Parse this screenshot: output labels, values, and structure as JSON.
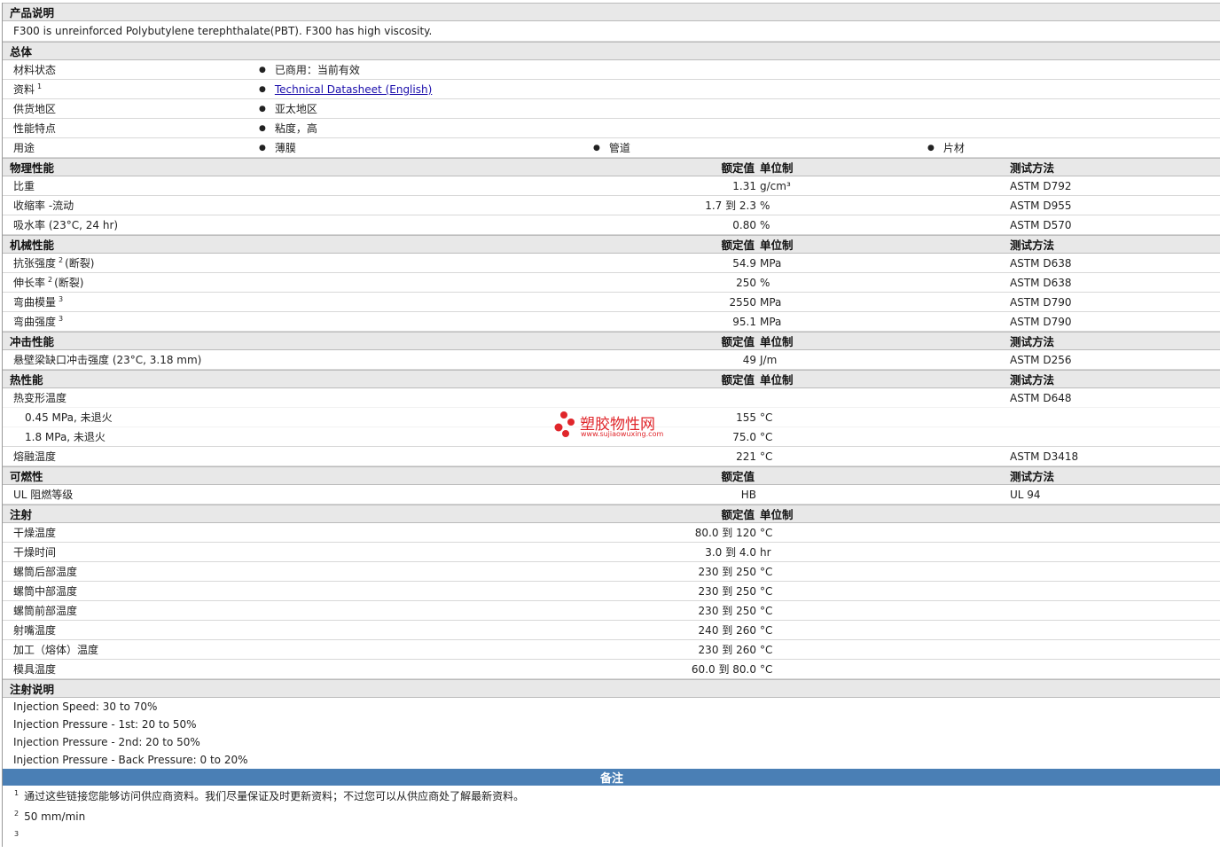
{
  "product_desc": {
    "header": "产品说明",
    "text": "F300 is unreinforced Polybutylene terephthalate(PBT). F300 has high viscosity."
  },
  "general": {
    "header": "总体",
    "status_label": "材料状态",
    "status_value": "已商用：当前有效",
    "resource_label": "资料",
    "resource_sup": "1",
    "resource_link": "Technical Datasheet (English)",
    "region_label": "供货地区",
    "region_value": "亚太地区",
    "features_label": "性能特点",
    "features_value": "粘度，高",
    "uses_label": "用途",
    "uses": [
      "薄膜",
      "管道",
      "片材"
    ]
  },
  "col_headers": {
    "value": "额定值",
    "unit": "单位制",
    "test": "测试方法"
  },
  "physical": {
    "header": "物理性能",
    "rows": [
      {
        "label": "比重",
        "value": "1.31",
        "unit": "g/cm³",
        "test": "ASTM D792"
      },
      {
        "label": "收缩率 -流动",
        "value": "1.7 到  2.3",
        "unit": "%",
        "test": "ASTM D955"
      },
      {
        "label": "吸水率  (23°C, 24 hr)",
        "value": "0.80",
        "unit": "%",
        "test": "ASTM D570"
      }
    ]
  },
  "mechanical": {
    "header": "机械性能",
    "rows": [
      {
        "label": "抗张强度",
        "sup": "2",
        "suffix": "(断裂)",
        "value": "54.9",
        "unit": "MPa",
        "test": "ASTM D638"
      },
      {
        "label": "伸长率",
        "sup": "2",
        "suffix": "(断裂)",
        "value": "250",
        "unit": "%",
        "test": "ASTM D638"
      },
      {
        "label": "弯曲模量",
        "sup": "3",
        "suffix": "",
        "value": "2550",
        "unit": "MPa",
        "test": "ASTM D790"
      },
      {
        "label": "弯曲强度",
        "sup": "3",
        "suffix": "",
        "value": "95.1",
        "unit": "MPa",
        "test": "ASTM D790"
      }
    ]
  },
  "impact": {
    "header": "冲击性能",
    "rows": [
      {
        "label": "悬壁梁缺口冲击强度  (23°C, 3.18 mm)",
        "value": "49",
        "unit": "J/m",
        "test": "ASTM D256"
      }
    ]
  },
  "thermal": {
    "header": "热性能",
    "hdt_label": "热变形温度",
    "hdt_test": "ASTM D648",
    "hdt_rows": [
      {
        "label": "0.45 MPa, 未退火",
        "value": "155",
        "unit": "°C"
      },
      {
        "label": "1.8 MPa, 未退火",
        "value": "75.0",
        "unit": "°C"
      }
    ],
    "melt_label": "熔融温度",
    "melt_value": "221",
    "melt_unit": "°C",
    "melt_test": "ASTM D3418"
  },
  "flammability": {
    "header": "可燃性",
    "label": "UL 阻燃等级",
    "value": "HB",
    "test": "UL 94"
  },
  "injection": {
    "header": "注射",
    "rows": [
      {
        "label": "干燥温度",
        "value": "80.0 到  120",
        "unit": "°C"
      },
      {
        "label": "干燥时间",
        "value": "3.0 到  4.0",
        "unit": "hr"
      },
      {
        "label": "螺筒后部温度",
        "value": "230 到  250",
        "unit": "°C"
      },
      {
        "label": "螺筒中部温度",
        "value": "230 到  250",
        "unit": "°C"
      },
      {
        "label": "螺筒前部温度",
        "value": "230 到  250",
        "unit": "°C"
      },
      {
        "label": "射嘴温度",
        "value": "240 到  260",
        "unit": "°C"
      },
      {
        "label": "加工（熔体）温度",
        "value": "230 到  260",
        "unit": "°C"
      },
      {
        "label": "模具温度",
        "value": "60.0 到  80.0",
        "unit": "°C"
      }
    ]
  },
  "injection_notes": {
    "header": "注射说明",
    "lines": [
      "Injection Speed: 30 to 70%",
      "Injection Pressure - 1st: 20 to 50%",
      "Injection Pressure - 2nd: 20 to 50%",
      "Injection Pressure - Back Pressure: 0 to 20%"
    ]
  },
  "remarks": {
    "header": "备注",
    "notes": [
      {
        "num": "1",
        "text": "通过这些链接您能够访问供应商资料。我们尽量保证及时更新资料；不过您可以从供应商处了解最新资料。"
      },
      {
        "num": "2",
        "text": "50 mm/min"
      },
      {
        "num": "3",
        "text": ""
      }
    ]
  },
  "watermark": {
    "title": "塑胶物性网",
    "url": "www.sujiaowuxing.com",
    "color": "#e0262b"
  }
}
